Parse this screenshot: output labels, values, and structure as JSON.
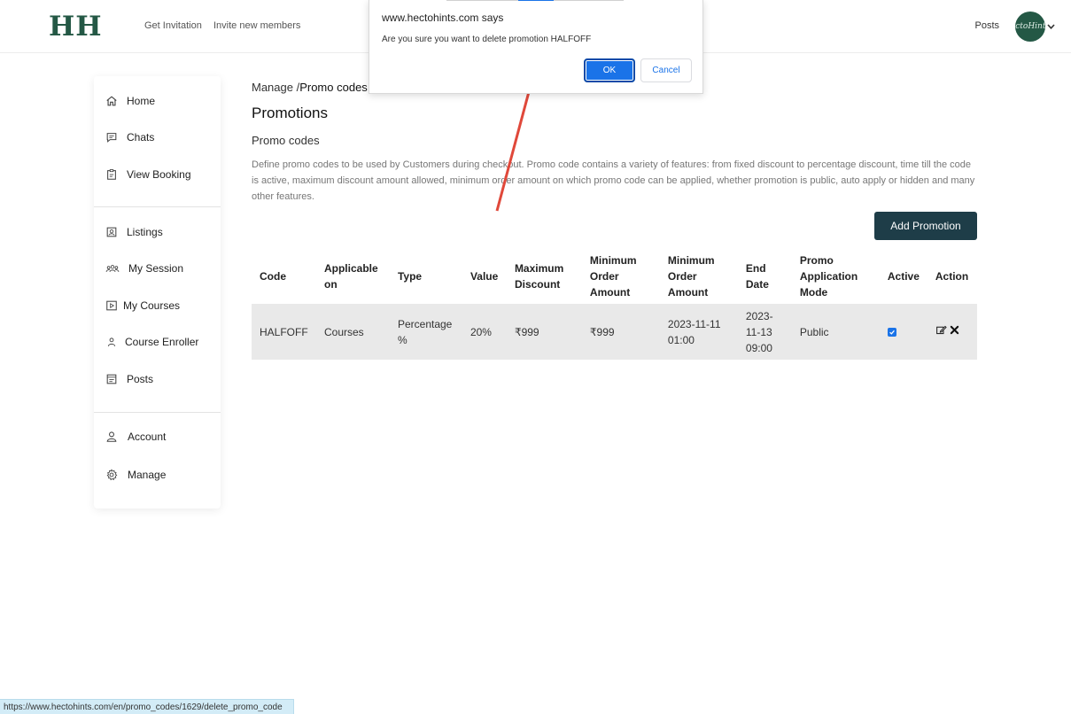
{
  "header": {
    "logo": "HH",
    "nav": [
      "Get Invitation",
      "Invite new members"
    ],
    "posts_link": "Posts",
    "avatar_text": "ectoHints"
  },
  "sidebar": {
    "items": [
      {
        "label": "Home",
        "icon": "home-icon"
      },
      {
        "label": "Chats",
        "icon": "chat-icon"
      },
      {
        "label": "View Booking",
        "icon": "clipboard-icon"
      },
      {
        "label": "Listings",
        "icon": "id-card-icon"
      },
      {
        "label": "My Session",
        "icon": "group-icon"
      },
      {
        "label": "My Courses",
        "icon": "play-icon"
      },
      {
        "label": "Course Enroller",
        "icon": "person-icon"
      },
      {
        "label": "Posts",
        "icon": "window-icon"
      },
      {
        "label": "Account",
        "icon": "user-icon"
      },
      {
        "label": "Manage",
        "icon": "gear-icon"
      }
    ]
  },
  "main": {
    "breadcrumb_root": "Manage /",
    "breadcrumb_current": "Promo codes",
    "title": "Promotions",
    "section_title": "Promo codes",
    "description": "Define promo codes to be used by Customers during checkout. Promo code contains a variety of features: from fixed discount to percentage discount, time till the code is active, maximum discount amount allowed, minimum order amount on which promo code can be applied, whether promotion is public, auto apply or hidden and many other features.",
    "add_button": "Add Promotion"
  },
  "table": {
    "headers": [
      "Code",
      "Applicable on",
      "Type",
      "Value",
      "Maximum Discount",
      "Minimum Order Amount",
      "Minimum Order Amount",
      "End Date",
      "Promo Application Mode",
      "Active",
      "Action"
    ],
    "rows": [
      {
        "code": "HALFOFF",
        "applicable_on": "Courses",
        "type": "Percentage %",
        "value": "20%",
        "max_discount": "₹999",
        "min_order_amount": "₹999",
        "min_order_amount_2": "2023-11-11 01:00",
        "end_date": "2023-11-13 09:00",
        "mode": "Public",
        "active": true
      }
    ]
  },
  "dialog": {
    "title": "www.hectohints.com says",
    "message": "Are you sure you want to delete promotion HALFOFF",
    "ok": "OK",
    "cancel": "Cancel"
  },
  "status_url": "https://www.hectohints.com/en/promo_codes/1629/delete_promo_code",
  "colors": {
    "brand": "#245845",
    "button_dark": "#1e3d48",
    "dialog_blue": "#1a73e8",
    "arrow": "#e0483a"
  }
}
